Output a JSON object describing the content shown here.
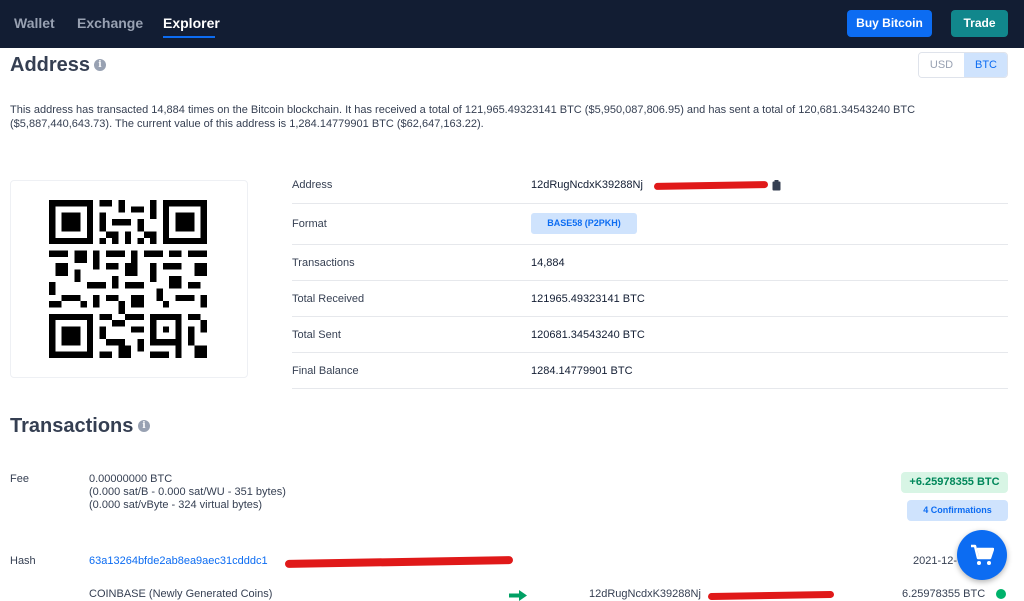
{
  "nav": {
    "tabs": [
      {
        "label": "Wallet"
      },
      {
        "label": "Exchange"
      },
      {
        "label": "Explorer"
      }
    ],
    "buy_label": "Buy Bitcoin",
    "trade_label": "Trade"
  },
  "address_section": {
    "title": "Address",
    "currency_toggle": {
      "usd": "USD",
      "btc": "BTC",
      "selected": "BTC"
    },
    "summary": "This address has transacted 14,884 times on the Bitcoin blockchain. It has received a total of 121,965.49323141 BTC ($5,950,087,806.95) and has sent a total of 120,681.34543240 BTC ($5,887,440,643.73). The current value of this address is 1,284.14779901 BTC ($62,647,163.22).",
    "details": [
      {
        "label": "Address",
        "value": "12dRugNcdxK39288Nj"
      },
      {
        "label": "Format",
        "value": "BASE58 (P2PKH)"
      },
      {
        "label": "Transactions",
        "value": "14,884"
      },
      {
        "label": "Total Received",
        "value": "121965.49323141 BTC"
      },
      {
        "label": "Total Sent",
        "value": "120681.34543240 BTC"
      },
      {
        "label": "Final Balance",
        "value": "1284.14779901 BTC"
      }
    ]
  },
  "transactions": {
    "title": "Transactions",
    "fee_label": "Fee",
    "fee_lines": [
      "0.00000000 BTC",
      "(0.000 sat/B - 0.000 sat/WU - 351 bytes)",
      "(0.000 sat/vByte - 324 virtual bytes)"
    ],
    "amount": "+6.25978355 BTC",
    "confirmations": "4 Confirmations",
    "hash_label": "Hash",
    "hash": "63a13264bfde2ab8ea9aec31cdddc1",
    "date": "2021-12-",
    "input": "COINBASE (Newly Generated Coins)",
    "output_address": "12dRugNcdxK39288Nj",
    "output_amount": "6.25978355 BTC"
  },
  "icons": {
    "info": "info-icon",
    "copy": "clipboard-icon",
    "cart": "shopping-cart-icon",
    "arrow": "arrow-right-icon",
    "globe": "globe-icon"
  },
  "colors": {
    "nav_bg": "#121d33",
    "primary": "#0c6cf2",
    "trade": "#11878c",
    "positive": "#00875a",
    "redaction": "#e01919"
  }
}
